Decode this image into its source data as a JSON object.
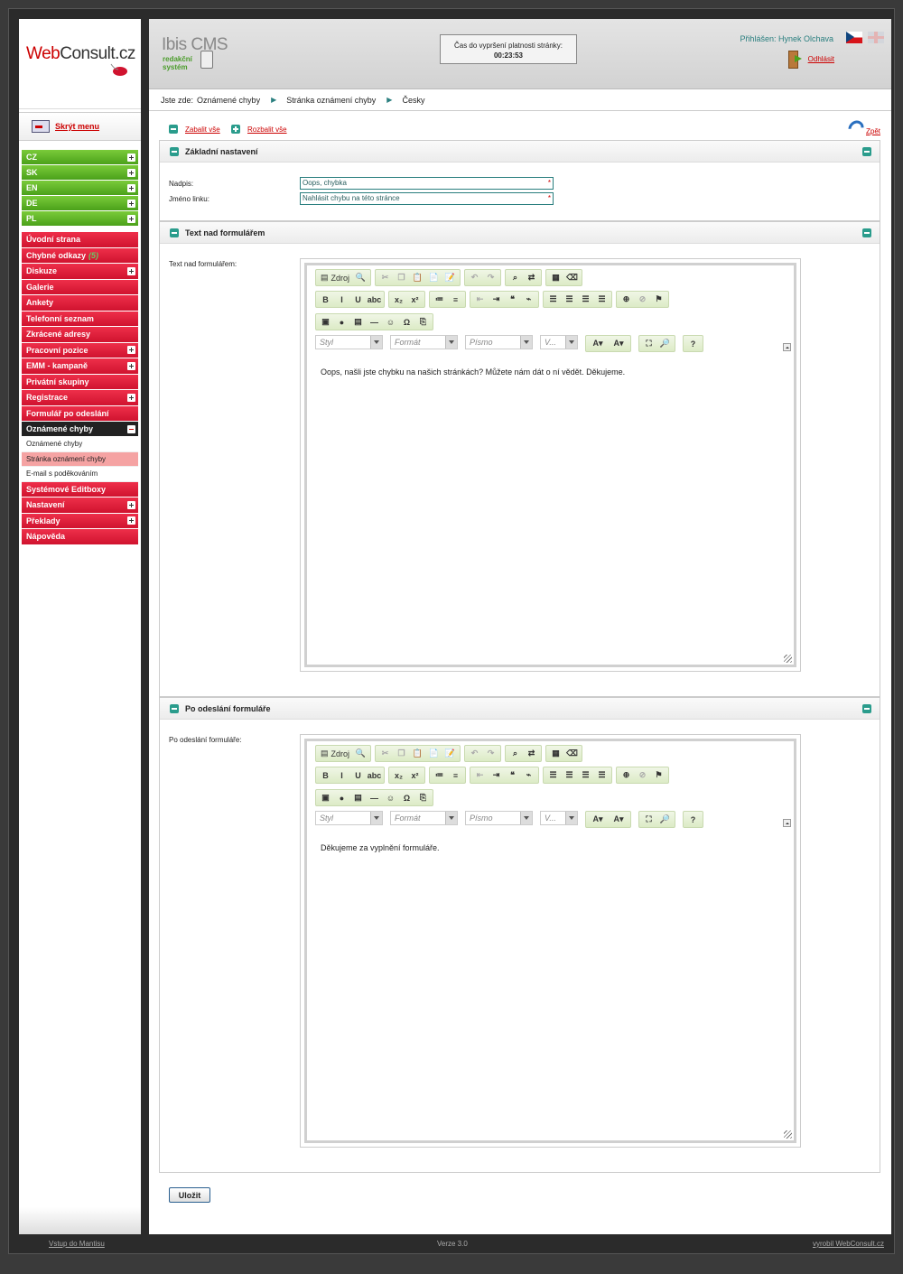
{
  "sidebar": {
    "logo": {
      "part1": "Web",
      "part2": "Consult.cz"
    },
    "hide_menu": "Skrýt menu",
    "languages": [
      {
        "label": "CZ"
      },
      {
        "label": "SK"
      },
      {
        "label": "EN"
      },
      {
        "label": "DE"
      },
      {
        "label": "PL"
      }
    ],
    "menu": [
      {
        "label": "Úvodní strana",
        "expandable": false
      },
      {
        "label": "Chybné odkazy",
        "count": "(5)",
        "expandable": false
      },
      {
        "label": "Diskuze",
        "expandable": true
      },
      {
        "label": "Galerie",
        "expandable": false
      },
      {
        "label": "Ankety",
        "expandable": false
      },
      {
        "label": "Telefonní seznam",
        "expandable": false
      },
      {
        "label": "Zkrácené adresy",
        "expandable": false
      },
      {
        "label": "Pracovní pozice",
        "expandable": true
      },
      {
        "label": "EMM - kampaně",
        "expandable": true
      },
      {
        "label": "Privátní skupiny",
        "expandable": false
      },
      {
        "label": "Registrace",
        "expandable": true
      },
      {
        "label": "Formulář po odeslání",
        "expandable": false
      }
    ],
    "active_section": {
      "label": "Oznámené chyby",
      "children": [
        {
          "label": "Oznámené chyby",
          "active": false
        },
        {
          "label": "Stránka oznámení chyby",
          "active": true
        },
        {
          "label": "E-mail s poděkováním",
          "active": false
        }
      ]
    },
    "menu_after": [
      {
        "label": "Systémové Editboxy",
        "expandable": false
      },
      {
        "label": "Nastavení",
        "expandable": true
      },
      {
        "label": "Překlady",
        "expandable": true
      },
      {
        "label": "Nápověda",
        "expandable": false
      }
    ]
  },
  "header": {
    "cms_title": "Ibis CMS",
    "cms_sub1": "redakční",
    "cms_sub2": "systém",
    "timer_label": "Čas do vypršení platnosti stránky:",
    "timer_value": "00:23:53",
    "user_label": "Přihlášen: Hynek Olchava",
    "logout": "Odhlásit"
  },
  "breadcrumb": {
    "prefix": "Jste zde:",
    "items": [
      "Oznámené chyby",
      "Stránka oznámení chyby",
      "Česky"
    ]
  },
  "actions": {
    "collapse_all": "Zabalit vše",
    "expand_all": "Rozbalit vše",
    "back": "Zpět"
  },
  "panels": {
    "basic": {
      "title": "Základní nastavení",
      "heading_label": "Nadpis:",
      "heading_value": "Oops, chybka",
      "link_label": "Jméno linku:",
      "link_value": "Nahlásit chybu na této stránce"
    },
    "above_form": {
      "title": "Text nad formulářem",
      "field_label": "Text nad formulářem:",
      "content": "Oops, našli jste chybku na našich stránkách? Můžete nám dát o ní vědět. Děkujeme."
    },
    "after_submit": {
      "title": "Po odeslání formuláře",
      "field_label": "Po odeslání formuláře:",
      "content": "Děkujeme za vyplnění formuláře."
    }
  },
  "editor": {
    "source": "Zdroj",
    "combo_style": "Styl",
    "combo_format": "Formát",
    "combo_font": "Písmo",
    "combo_size": "V..."
  },
  "save": "Uložit",
  "footer": {
    "left": "Vstup do Mantisu",
    "version": "Verze 3.0",
    "right": "vyrobil WebConsult.cz"
  }
}
